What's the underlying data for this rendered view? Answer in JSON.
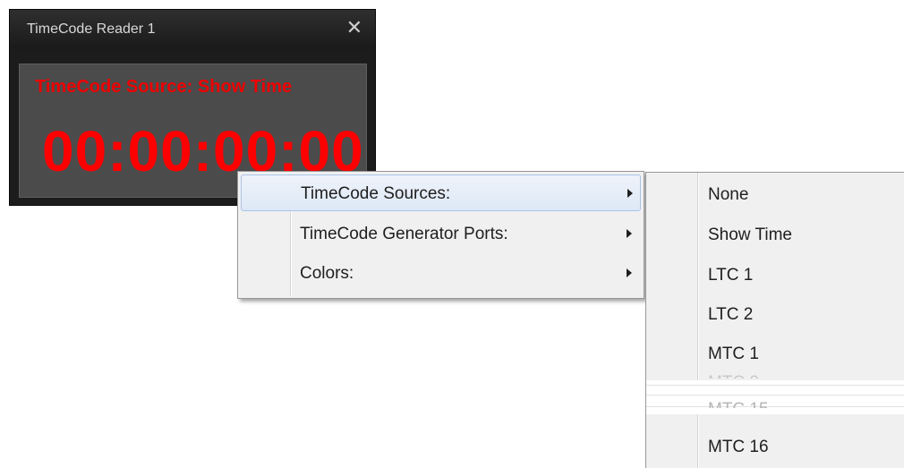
{
  "window": {
    "title": "TimeCode Reader 1",
    "close_glyph": "✕",
    "source_text": "TimeCode Source: Show Time",
    "timecode": "00:00:00:00",
    "accent_color": "#ff0000"
  },
  "context_menu": {
    "items": [
      {
        "label": "TimeCode Sources:",
        "has_submenu": true,
        "highlighted": true
      },
      {
        "label": "TimeCode Generator Ports:",
        "has_submenu": true,
        "highlighted": false
      },
      {
        "label": "Colors:",
        "has_submenu": true,
        "highlighted": false
      }
    ]
  },
  "submenu": {
    "items": [
      {
        "label": "None"
      },
      {
        "label": "Show Time"
      },
      {
        "label": "LTC 1"
      },
      {
        "label": "LTC 2"
      },
      {
        "label": "MTC 1"
      },
      {
        "label": "MTC 16"
      }
    ],
    "partial_items": [
      "MTC 2",
      "MTC 15"
    ]
  }
}
